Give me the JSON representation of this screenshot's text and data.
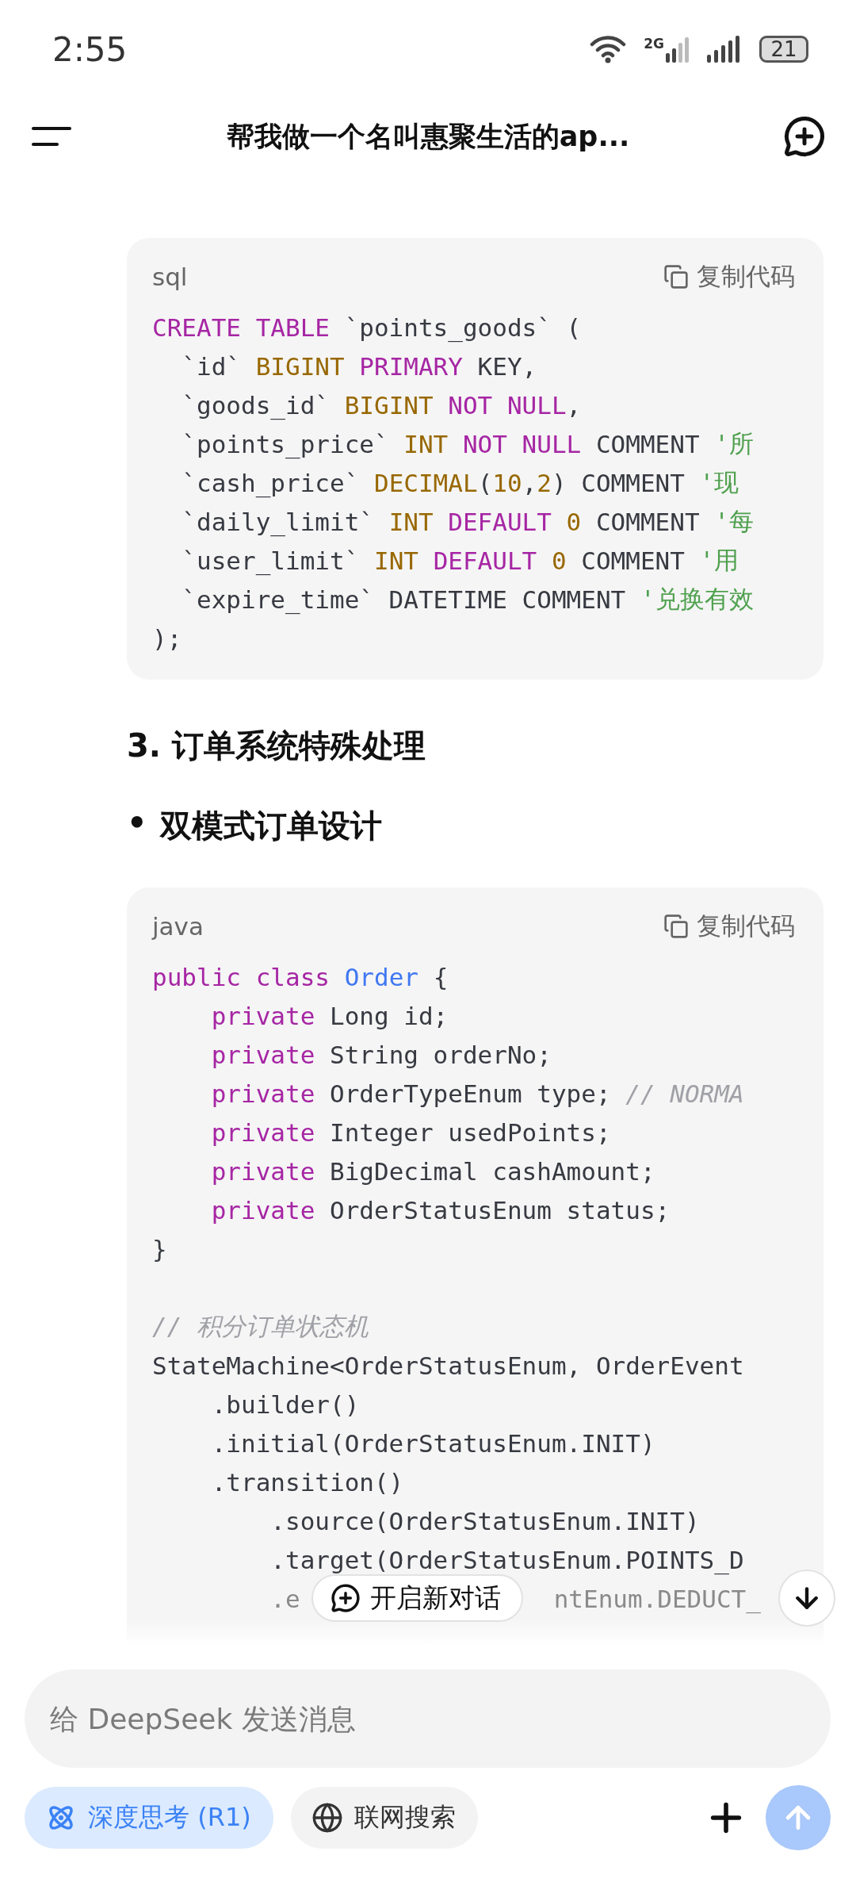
{
  "status_bar": {
    "time": "2:55",
    "network": "2G",
    "battery": "21"
  },
  "header": {
    "title": "帮我做一个名叫惠聚生活的ap..."
  },
  "content": [
    {
      "kind": "code",
      "language": "sql",
      "copy_label": "复制代码",
      "lines": [
        {
          "kind": "code",
          "tokens": [
            {
              "kind": "keyword",
              "text": "CREATE TABLE"
            },
            {
              "kind": "plain",
              "text": " `points_goods` ("
            }
          ]
        },
        {
          "kind": "code",
          "tokens": [
            {
              "kind": "plain",
              "text": "  `id` "
            },
            {
              "kind": "type",
              "text": "BIGINT"
            },
            {
              "kind": "keyword",
              "text": " PRIMARY"
            },
            {
              "kind": "plain",
              "text": " KEY,"
            }
          ]
        },
        {
          "kind": "code",
          "tokens": [
            {
              "kind": "plain",
              "text": "  `goods_id` "
            },
            {
              "kind": "type",
              "text": "BIGINT"
            },
            {
              "kind": "keyword",
              "text": " NOT NULL"
            },
            {
              "kind": "plain",
              "text": ","
            }
          ]
        },
        {
          "kind": "code",
          "tokens": [
            {
              "kind": "plain",
              "text": "  `points_price` "
            },
            {
              "kind": "type",
              "text": "INT"
            },
            {
              "kind": "keyword",
              "text": " NOT NULL"
            },
            {
              "kind": "plain",
              "text": " COMMENT "
            },
            {
              "kind": "string",
              "text": "'所"
            }
          ]
        },
        {
          "kind": "code",
          "tokens": [
            {
              "kind": "plain",
              "text": "  `cash_price` "
            },
            {
              "kind": "type",
              "text": "DECIMAL"
            },
            {
              "kind": "plain",
              "text": "("
            },
            {
              "kind": "number",
              "text": "10"
            },
            {
              "kind": "plain",
              "text": ","
            },
            {
              "kind": "number",
              "text": "2"
            },
            {
              "kind": "plain",
              "text": ") COMMENT "
            },
            {
              "kind": "string",
              "text": "'现"
            }
          ]
        },
        {
          "kind": "code",
          "tokens": [
            {
              "kind": "plain",
              "text": "  `daily_limit` "
            },
            {
              "kind": "type",
              "text": "INT"
            },
            {
              "kind": "keyword",
              "text": " DEFAULT"
            },
            {
              "kind": "number",
              "text": " 0"
            },
            {
              "kind": "plain",
              "text": " COMMENT "
            },
            {
              "kind": "string",
              "text": "'每"
            }
          ]
        },
        {
          "kind": "code",
          "tokens": [
            {
              "kind": "plain",
              "text": "  `user_limit` "
            },
            {
              "kind": "type",
              "text": "INT"
            },
            {
              "kind": "keyword",
              "text": " DEFAULT"
            },
            {
              "kind": "number",
              "text": " 0"
            },
            {
              "kind": "plain",
              "text": " COMMENT "
            },
            {
              "kind": "string",
              "text": "'用"
            }
          ]
        },
        {
          "kind": "code",
          "tokens": [
            {
              "kind": "plain",
              "text": "  `expire_time` DATETIME COMMENT "
            },
            {
              "kind": "string",
              "text": "'兑换有效"
            }
          ]
        },
        {
          "kind": "code",
          "tokens": [
            {
              "kind": "plain",
              "text": ");"
            }
          ]
        }
      ]
    },
    {
      "kind": "heading",
      "text": "3. 订单系统特殊处理"
    },
    {
      "kind": "bullet",
      "marker": "•",
      "text": "双模式订单设计"
    },
    {
      "kind": "code",
      "language": "java",
      "copy_label": "复制代码",
      "lines": [
        {
          "kind": "code",
          "tokens": [
            {
              "kind": "keyword",
              "text": "public class "
            },
            {
              "kind": "class",
              "text": "Order"
            },
            {
              "kind": "plain",
              "text": " {"
            }
          ]
        },
        {
          "kind": "code",
          "tokens": [
            {
              "kind": "keyword",
              "text": "    private"
            },
            {
              "kind": "plain",
              "text": " Long id;"
            }
          ]
        },
        {
          "kind": "code",
          "tokens": [
            {
              "kind": "keyword",
              "text": "    private"
            },
            {
              "kind": "plain",
              "text": " String orderNo;"
            }
          ]
        },
        {
          "kind": "code",
          "tokens": [
            {
              "kind": "keyword",
              "text": "    private"
            },
            {
              "kind": "plain",
              "text": " OrderTypeEnum type; "
            },
            {
              "kind": "comment",
              "text": "// NORMA"
            }
          ]
        },
        {
          "kind": "code",
          "tokens": [
            {
              "kind": "keyword",
              "text": "    private"
            },
            {
              "kind": "plain",
              "text": " Integer usedPoints;"
            }
          ]
        },
        {
          "kind": "code",
          "tokens": [
            {
              "kind": "keyword",
              "text": "    private"
            },
            {
              "kind": "plain",
              "text": " BigDecimal cashAmount;"
            }
          ]
        },
        {
          "kind": "code",
          "tokens": [
            {
              "kind": "keyword",
              "text": "    private"
            },
            {
              "kind": "plain",
              "text": " OrderStatusEnum status;"
            }
          ]
        },
        {
          "kind": "code",
          "tokens": [
            {
              "kind": "plain",
              "text": "}"
            }
          ]
        },
        {
          "kind": "blank"
        },
        {
          "kind": "code",
          "tokens": [
            {
              "kind": "comment",
              "text": "// 积分订单状态机"
            }
          ]
        },
        {
          "kind": "code",
          "tokens": [
            {
              "kind": "plain",
              "text": "StateMachine<OrderStatusEnum, OrderEvent"
            }
          ]
        },
        {
          "kind": "code",
          "tokens": [
            {
              "kind": "plain",
              "text": "    .builder()"
            }
          ]
        },
        {
          "kind": "code",
          "tokens": [
            {
              "kind": "plain",
              "text": "    .initial(OrderStatusEnum.INIT)"
            }
          ]
        },
        {
          "kind": "code",
          "tokens": [
            {
              "kind": "plain",
              "text": "    .transition()"
            }
          ]
        },
        {
          "kind": "code",
          "tokens": [
            {
              "kind": "plain",
              "text": "        .source(OrderStatusEnum.INIT)"
            }
          ]
        },
        {
          "kind": "code",
          "tokens": [
            {
              "kind": "plain",
              "text": "        .target(OrderStatusEnum.POINTS_D"
            }
          ]
        },
        {
          "kind": "covered",
          "tokens": [
            {
              "kind": "plain",
              "text": "        .e"
            },
            {
              "kind": "plain",
              "text": "ntEnum.DEDUCT_"
            }
          ]
        }
      ]
    }
  ],
  "new_chat_button": {
    "label": "开启新对话"
  },
  "composer": {
    "placeholder": "给 DeepSeek 发送消息",
    "chips": [
      {
        "kind": "deep-think",
        "label": "深度思考 (R1)",
        "selected": true
      },
      {
        "kind": "web-search",
        "label": "联网搜索",
        "selected": false
      }
    ],
    "send_disabled": true
  }
}
